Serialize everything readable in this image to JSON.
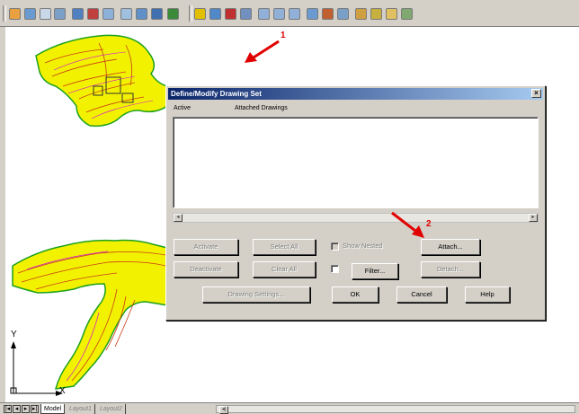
{
  "toolbar": {
    "icons": [
      "layer-icon",
      "zoom-window-icon",
      "drawing-set-icon",
      "query-icon",
      "save-icon",
      "view-icon",
      "map-icon",
      "attach-icon",
      "export-icon",
      "globe-icon",
      "print-icon",
      "lightning-icon",
      "define-drawing-set-icon",
      "query-library-icon",
      "zoom-search-icon",
      "map-tool-icon",
      "map-tool-icon",
      "map-tool-icon",
      "object-data-icon",
      "book-icon",
      "properties-icon",
      "topology-icon",
      "annotation-icon",
      "table-icon",
      "grid-icon"
    ]
  },
  "annotations": {
    "arrow1_number": "1",
    "arrow2_number": "2",
    "color": "#e00000"
  },
  "dialog": {
    "title": "Define/Modify Drawing Set",
    "close_label": "×",
    "columns": {
      "active": "Active",
      "attached": "Attached Drawings"
    },
    "scroll_left": "◂",
    "scroll_right": "▸",
    "buttons": {
      "activate": "Activate",
      "select_all": "Select All",
      "attach": "Attach...",
      "deactivate": "Deactivate",
      "clear_all": "Clear All",
      "filter": "Filter...",
      "detach": "Detach...",
      "drawing_settings": "Drawing Settings...",
      "ok": "OK",
      "cancel": "Cancel",
      "help": "Help"
    },
    "checkboxes": {
      "show_nested": "Show Nested"
    }
  },
  "ucs": {
    "y_label": "Y",
    "x_label": "X"
  },
  "tabs": {
    "nav": [
      "|◂",
      "◂",
      "▸",
      "▸|"
    ],
    "items": [
      {
        "label": "Model",
        "active": true
      },
      {
        "label": "Layout1",
        "active": false
      },
      {
        "label": "Layout2",
        "active": false
      }
    ],
    "scroll_arrow": "◂|"
  },
  "colors": {
    "map_fill": "#f2f200",
    "map_lines": "#c83c14",
    "map_edge": "#1ea01e",
    "map_accent": "#d214d2",
    "dialog_bg": "#d4d0c8",
    "title_start": "#0a246a",
    "title_end": "#a6caf0"
  }
}
